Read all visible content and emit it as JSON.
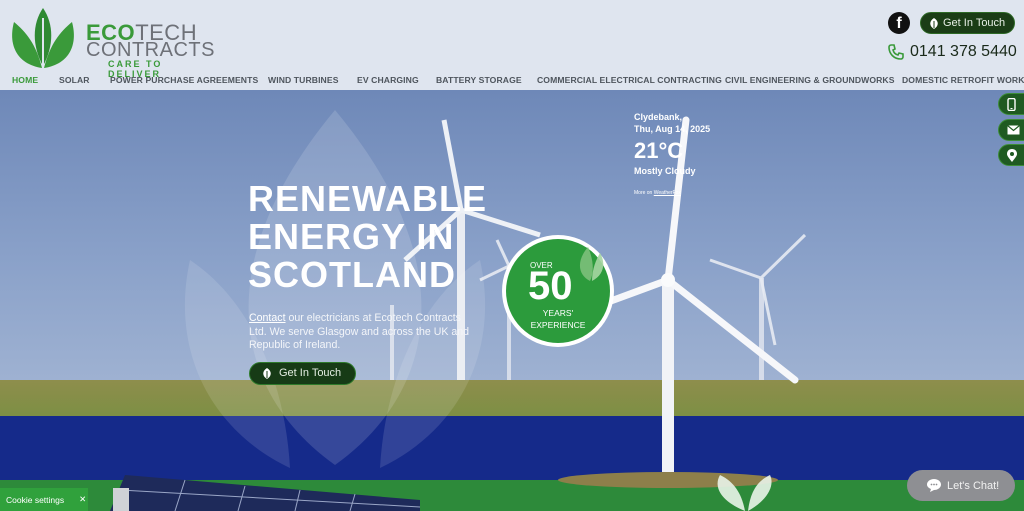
{
  "brand": {
    "eco": "ECO",
    "tech": "TECH",
    "contracts": "CONTRACTS",
    "tagline": "CARE TO DELIVER",
    "green": "#3a9a3a",
    "dark_green": "#1b3d16"
  },
  "header": {
    "facebook_icon": "facebook-icon",
    "get_in_touch_label": "Get In Touch",
    "phone_number": "0141 378 5440"
  },
  "nav": {
    "items": [
      {
        "label": "HOME",
        "active": true
      },
      {
        "label": "SOLAR"
      },
      {
        "label": "POWER PURCHASE AGREEMENTS"
      },
      {
        "label": "WIND TURBINES"
      },
      {
        "label": "EV CHARGING"
      },
      {
        "label": "BATTERY STORAGE"
      },
      {
        "label": "COMMERCIAL ELECTRICAL CONTRACTING"
      },
      {
        "label": "CIVIL ENGINEERING & GROUNDWORKS"
      },
      {
        "label": "DOMESTIC RETROFIT WORK"
      }
    ]
  },
  "hero": {
    "title_line1": "RENEWABLE",
    "title_line2": "ENERGY IN",
    "title_line3": "SCOTLAND",
    "contact_link": "Contact",
    "body_text": " our electricians at Ecotech Contracts Ltd. We serve Glasgow and across the UK and Republic of Ireland.",
    "cta_label": "Get In Touch"
  },
  "badge": {
    "over": "OVER",
    "number": "50",
    "years": "YEARS'",
    "experience": "EXPERIENCE"
  },
  "weather": {
    "location": "Clydebank,",
    "date": "Thu, Aug 14, 2025",
    "temperature": "21°C",
    "condition": "Mostly Cloudy",
    "more_prefix": "More on ",
    "more_link": "WeatherFox"
  },
  "side_buttons": [
    "phone-icon",
    "mail-icon",
    "map-pin-icon"
  ],
  "chat": {
    "label": "Let's Chat!"
  },
  "cookie": {
    "label": "Cookie settings",
    "close": "✕"
  }
}
